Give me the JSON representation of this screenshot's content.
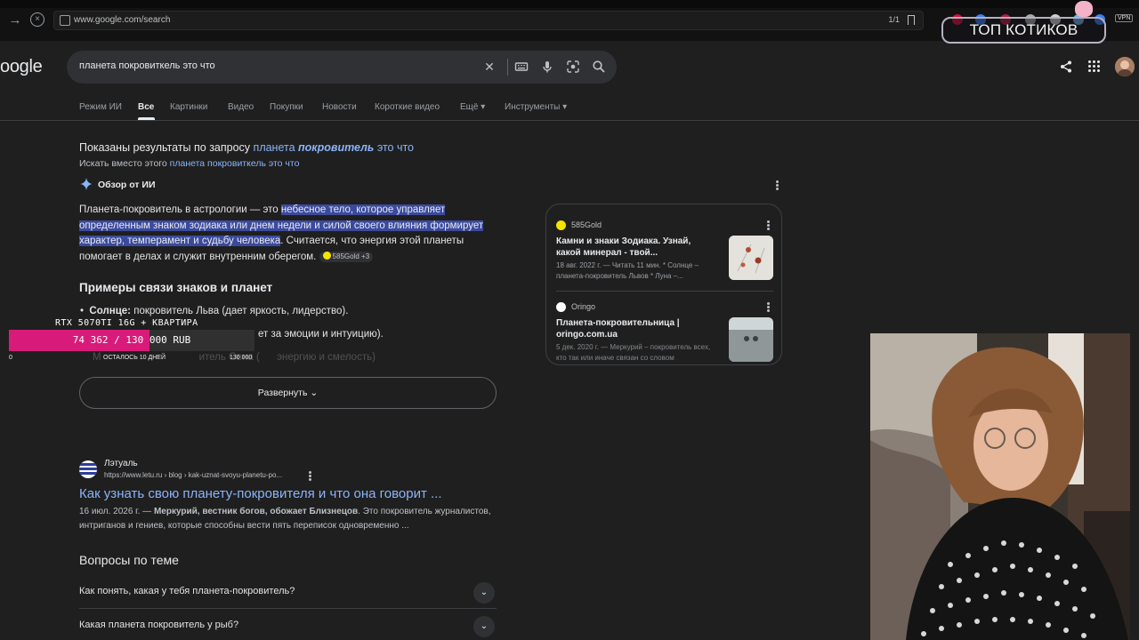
{
  "browser": {
    "url": "www.google.com/search",
    "page_counter": "1/1",
    "vpn_label": "VPN"
  },
  "stream_overlay": {
    "title": "ТОП КОТИКОВ",
    "goal_name": "RTX 5070TI 16G + КВАРТИРА",
    "goal_progress_text": "74 362 / 130 000 RUB",
    "goal_progress_fraction": 0.572,
    "goal_min": "0",
    "goal_remaining": "ОСТАЛОСЬ 10 ДНЕЙ",
    "goal_max": "130 000",
    "goal_color": "#d81b7a"
  },
  "google": {
    "logo_text": "oogle",
    "query": "планета покровиткель это что",
    "tabs": [
      {
        "label": "Режим ИИ",
        "active": false
      },
      {
        "label": "Все",
        "active": true
      },
      {
        "label": "Картинки",
        "active": false
      },
      {
        "label": "Видео",
        "active": false
      },
      {
        "label": "Покупки",
        "active": false
      },
      {
        "label": "Новости",
        "active": false
      },
      {
        "label": "Короткие видео",
        "active": false
      },
      {
        "label": "Ещё",
        "active": false
      },
      {
        "label": "Инструменты",
        "active": false
      }
    ]
  },
  "correction": {
    "prefix": "Показаны результаты по запросу",
    "corrected_part1": "планета",
    "corrected_emph": "покровитель",
    "corrected_part2": "это что",
    "instead_label": "Искать вместо этого",
    "instead_query": "планета покровиткель это что"
  },
  "ai_overview": {
    "title": "Обзор от ИИ",
    "intro": "Планета-покровитель в астрологии — это ",
    "highlight": "небесное тело, которое управляет определенным знаком зодиака или днем недели и силой своего влияния формирует характер, темперамент и судьбу человека",
    "rest": ". Считается, что энергия этой планеты помогает в делах и служит внутренним оберегом.",
    "chip": "585Gold +3",
    "examples_heading": "Примеры связи знаков и планет",
    "bullet1_label": "Солнце:",
    "bullet1_text": " покровитель Льва (дает яркость, лидерство).",
    "bullet2_tail": "ет за эмоции и интуицию).",
    "bullet3_a": "М",
    "bullet3_b": "итель Овна (",
    "bullet3_c": " энергию и смелость)",
    "expand_label": "Развернуть",
    "sources": [
      {
        "name": "585Gold",
        "title": "Камни и знаки Зодиака. Узнай, какой минерал - твой...",
        "snippet": "18 авг. 2022 г. — Читать 11 мин. * Солнце – планета-покровитель Львов * Луна –...",
        "dot_color": "#f3e500"
      },
      {
        "name": "Oringo",
        "title": "Планета-покровительница | oringo.com.ua",
        "snippet": "5 дек. 2020 г. — Меркурий – покровитель всех, кто так или иначе связан со словом",
        "dot_color": "#ffffff"
      }
    ]
  },
  "result": {
    "site_name": "Лэтуаль",
    "url": "https://www.letu.ru › blog › kak-uznat-svoyu-planetu-po...",
    "title": "Как узнать свою планету-покровителя и что она говорит ...",
    "date": "16 июл. 2026 г. — ",
    "snippet_bold": "Меркурий, вестник богов, обожает Близнецов",
    "snippet_rest": ". Это покровитель журналистов, интриганов и гениев, которые способны вести пять переписок одновременно ..."
  },
  "related": {
    "heading": "Вопросы по теме",
    "questions": [
      "Как понять, какая у тебя планета-покровитель?",
      "Какая планета покровитель у рыб?"
    ]
  }
}
